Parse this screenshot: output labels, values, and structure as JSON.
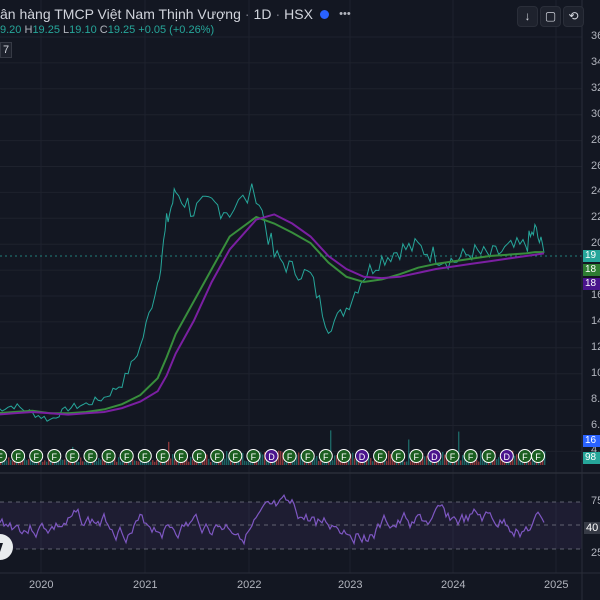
{
  "header": {
    "title": "ân hàng TMCP Việt Nam Thịnh Vượng",
    "interval": "1D",
    "exchange": "HSX",
    "sep": "·"
  },
  "ohlc": {
    "open_value": "9.20",
    "high_label": "H",
    "high_value": "19.25",
    "low_label": "L",
    "low_value": "19.10",
    "close_label": "C",
    "close_value": "19.25",
    "change": "+0.05 (+0.26%)"
  },
  "indicator_badge": "7",
  "toolbar": {
    "down_icon": "arrow-down-icon",
    "maximize_icon": "maximize-icon",
    "settings_icon": "settings-icon"
  },
  "price_axis": [
    "36",
    "34",
    "32",
    "30",
    "28",
    "26",
    "24",
    "22",
    "20",
    "18",
    "16",
    "14",
    "12",
    "10",
    "8.",
    "6.",
    "4."
  ],
  "price_tags": [
    {
      "text": "19",
      "color": "#26a69a"
    },
    {
      "text": "18",
      "color": "#2e7d32"
    },
    {
      "text": "18",
      "color": "#4a148c"
    },
    {
      "text": "16",
      "color": "#2962ff"
    },
    {
      "text": "98",
      "color": "#26a69a"
    }
  ],
  "rsi_axis": [
    "75",
    "40",
    "25"
  ],
  "time_axis": [
    "2020",
    "2021",
    "2022",
    "2023",
    "2024",
    "2025"
  ],
  "event_markers": [
    "F",
    "F",
    "F",
    "F",
    "F",
    "F",
    "F",
    "F",
    "F",
    "F",
    "F",
    "F",
    "F",
    "F",
    "F",
    "D",
    "F",
    "F",
    "F",
    "F",
    "D",
    "F",
    "F",
    "F",
    "D",
    "F",
    "F",
    "F",
    "D",
    "F",
    "F"
  ],
  "chart_data": {
    "type": "line",
    "x": [
      "2019-10",
      "2019-12",
      "2020-02",
      "2020-04",
      "2020-06",
      "2020-08",
      "2020-10",
      "2020-12",
      "2021-02",
      "2021-04",
      "2021-05",
      "2021-06",
      "2021-08",
      "2021-10",
      "2021-12",
      "2022-03",
      "2022-05",
      "2022-07",
      "2022-09",
      "2022-11",
      "2023-01",
      "2023-03",
      "2023-05",
      "2023-07",
      "2023-09",
      "2023-11",
      "2024-01",
      "2024-03",
      "2024-05",
      "2024-07",
      "2024-09",
      "2024-10",
      "2024-11"
    ],
    "series": [
      {
        "values": [
          7.2,
          7.5,
          6.9,
          6.4,
          7.3,
          7.6,
          8.1,
          9.2,
          12.0,
          17.0,
          21.5,
          24.0,
          22.5,
          23.0,
          22.5,
          24.0,
          19.0,
          18.0,
          17.5,
          13.5,
          15.0,
          17.5,
          18.8,
          19.5,
          19.7,
          19.0,
          18.6,
          19.3,
          19.0,
          19.5,
          19.8,
          21.0,
          19.25
        ],
        "color": "#26a69a"
      },
      {
        "values": [
          6.9,
          7.0,
          7.1,
          6.9,
          6.9,
          7.0,
          7.2,
          7.6,
          8.3,
          9.6,
          11.2,
          13.0,
          15.5,
          18.0,
          20.5,
          22.0,
          21.5,
          20.8,
          20.0,
          18.5,
          17.4,
          17.0,
          17.2,
          17.6,
          18.1,
          18.4,
          18.6,
          18.8,
          19.0,
          19.1,
          19.2,
          19.3,
          19.3
        ],
        "color": "#388e3c"
      },
      {
        "values": [
          6.8,
          6.9,
          7.0,
          6.9,
          6.8,
          6.9,
          7.0,
          7.3,
          7.8,
          8.6,
          9.8,
          11.5,
          14.0,
          17.0,
          19.5,
          21.8,
          22.2,
          21.5,
          20.5,
          19.0,
          18.0,
          17.4,
          17.3,
          17.4,
          17.7,
          18.0,
          18.2,
          18.4,
          18.6,
          18.8,
          19.0,
          19.1,
          19.2
        ],
        "color": "#7b1fa2"
      }
    ],
    "rsi_levels": [
      75,
      40,
      25
    ],
    "y_axis_price": [
      4,
      36
    ],
    "grid": true
  }
}
